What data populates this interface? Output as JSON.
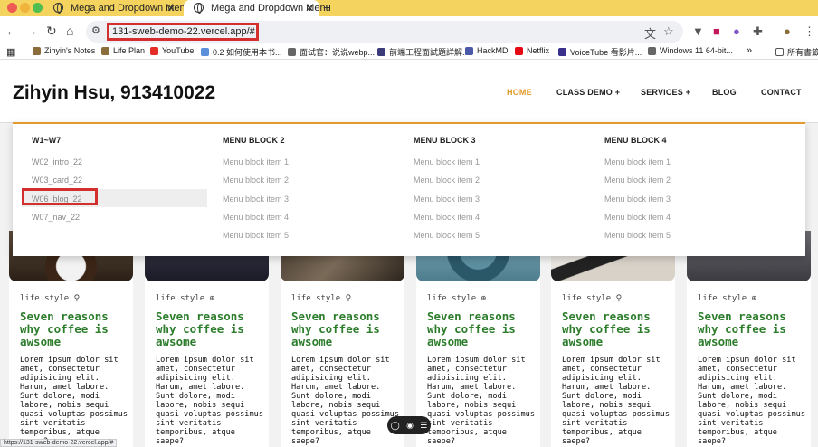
{
  "browser": {
    "tabs": [
      {
        "title": "Mega and Dropdown Menu",
        "active": false
      },
      {
        "title": "Mega and Dropdown Menu",
        "active": true
      }
    ],
    "new_tab": "+",
    "address": "131-sweb-demo-22.vercel.app/#",
    "bookmarks": [
      {
        "label": "Zihyin's Notes",
        "icon": "star-icon",
        "color": "#8a6d3b"
      },
      {
        "label": "Life Plan",
        "icon": "star-icon",
        "color": "#8a6d3b"
      },
      {
        "label": "YouTube",
        "icon": "youtube-icon",
        "color": "#e52d27"
      },
      {
        "label": "0.2 如何使用本书...",
        "icon": "bookmark-icon",
        "color": "#5b8fd9"
      },
      {
        "label": "面试官：说说webp...",
        "icon": "globe-icon",
        "color": "#666666"
      },
      {
        "label": "前端工程面試題詳解...",
        "icon": "e-icon",
        "color": "#3b3b7a"
      },
      {
        "label": "HackMD",
        "icon": "hackmd-icon",
        "color": "#4a5aa8"
      },
      {
        "label": "Netflix",
        "icon": "netflix-icon",
        "color": "#e50914"
      },
      {
        "label": "VoiceTube 看影片...",
        "icon": "voicetube-icon",
        "color": "#3a2f8a"
      },
      {
        "label": "Windows 11 64-bit...",
        "icon": "globe-icon",
        "color": "#666666"
      }
    ],
    "bookmarks_more": "»",
    "all_bookmarks": "所有書籤",
    "status_url": "https://131-sweb-demo-22.vercel.app/#"
  },
  "site": {
    "brand": "Zihyin Hsu, 913410022",
    "nav": [
      {
        "label": "HOME",
        "active": true
      },
      {
        "label": "CLASS DEMO +",
        "active": false
      },
      {
        "label": "SERVICES +",
        "active": false
      },
      {
        "label": "BLOG",
        "active": false
      },
      {
        "label": "CONTACT",
        "active": false
      }
    ],
    "accent_color": "#e19a2b"
  },
  "mega_menu": {
    "columns": [
      {
        "heading": "W1~W7",
        "items": [
          "W02_intro_22",
          "W03_card_22",
          "W06_blog_22",
          "W07_nav_22"
        ]
      },
      {
        "heading": "MENU BLOCK 2",
        "items": [
          "Menu block item 1",
          "Menu block item 2",
          "Menu block item 3",
          "Menu block item 4",
          "Menu block item 5"
        ]
      },
      {
        "heading": "MENU BLOCK 3",
        "items": [
          "Menu block item 1",
          "Menu block item 2",
          "Menu block item 3",
          "Menu block item 4",
          "Menu block item 5"
        ]
      },
      {
        "heading": "MENU BLOCK 4",
        "items": [
          "Menu block item 1",
          "Menu block item 2",
          "Menu block item 3",
          "Menu block item 4",
          "Menu block item 5"
        ]
      }
    ],
    "hovered_item": "W06_blog_22"
  },
  "cards": [
    {
      "tag": "life style",
      "tag_icon": "pin-icon",
      "title": "Seven reasons why coffee is awsome",
      "body": "Lorem ipsum dolor sit amet, consectetur adipisicing elit. Harum, amet labore. Sunt dolore, modi labore, nobis sequi quasi voluptas possimus sint veritatis temporibus, atque saepe?"
    },
    {
      "tag": "life style",
      "tag_icon": "globe-icon",
      "title": "Seven reasons why coffee is awsome",
      "body": "Lorem ipsum dolor sit amet, consectetur adipisicing elit. Harum, amet labore. Sunt dolore, modi labore, nobis sequi quasi voluptas possimus sint veritatis temporibus, atque saepe?"
    },
    {
      "tag": "life style",
      "tag_icon": "pin-icon",
      "title": "Seven reasons why coffee is awsome",
      "body": "Lorem ipsum dolor sit amet, consectetur adipisicing elit. Harum, amet labore. Sunt dolore, modi labore, nobis sequi quasi voluptas possimus sint veritatis temporibus, atque saepe?"
    },
    {
      "tag": "life style",
      "tag_icon": "globe-icon",
      "title": "Seven reasons why coffee is awsome",
      "body": "Lorem ipsum dolor sit amet, consectetur adipisicing elit. Harum, amet labore. Sunt dolore, modi labore, nobis sequi quasi voluptas possimus sint veritatis temporibus, atque saepe?"
    },
    {
      "tag": "life style",
      "tag_icon": "pin-icon",
      "title": "Seven reasons why coffee is awsome",
      "body": "Lorem ipsum dolor sit amet, consectetur adipisicing elit. Harum, amet labore. Sunt dolore, modi labore, nobis sequi quasi voluptas possimus sint veritatis temporibus, atque saepe?"
    },
    {
      "tag": "life style",
      "tag_icon": "globe-icon",
      "title": "Seven reasons why coffee is awsome",
      "body": "Lorem ipsum dolor sit amet, consectetur adipisicing elit. Harum, amet labore. Sunt dolore, modi labore, nobis sequi quasi voluptas possimus sint veritatis temporibus, atque saepe?"
    }
  ],
  "highlight_color": "#d32f2f"
}
